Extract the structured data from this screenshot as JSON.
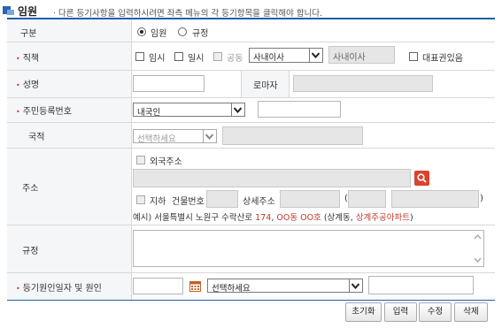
{
  "header": {
    "title": "임원",
    "description": "다른 등기사항을 입력하시려면 좌측 메뉴의 각 등기항목을 클릭해야 합니다."
  },
  "rows": {
    "gubun": {
      "label": "구분",
      "options": [
        "임원",
        "규정"
      ],
      "selected": "임원"
    },
    "position": {
      "label": "직책",
      "checkboxes": [
        "임시",
        "일시",
        "공동"
      ],
      "select_value": "사내이사",
      "readonly_value": "사내이사",
      "rep_checkbox": "대표권있음"
    },
    "name": {
      "label": "성명",
      "name_value": "",
      "roman_label": "로마자",
      "roman_value": ""
    },
    "rrn": {
      "label": "주민등록번호",
      "select_value": "내국인",
      "value": ""
    },
    "nationality": {
      "label": "국적",
      "select_placeholder": "선택하세요",
      "value": ""
    },
    "address": {
      "label": "주소",
      "foreign_checkbox": "외국주소",
      "basement_checkbox": "지하",
      "building_no_label": "건물번호",
      "detail_label": "상세주소",
      "paren_open": "(",
      "paren_close": ")",
      "example_prefix": "예시) 서울특별시 노원구 수락산로",
      "example_num": "174",
      "example_sep": ",",
      "example_dong": "OO동 OO호",
      "example_paren": "(상계동,",
      "example_apt": "상계주공아파트",
      "example_close": ")"
    },
    "rule": {
      "label": "규정",
      "value": ""
    },
    "reg_date": {
      "label": "등기원인일자 및 원인",
      "date_value": "",
      "select_placeholder": "선택하세요",
      "value": ""
    }
  },
  "buttons": {
    "reset": "초기화",
    "input": "입력",
    "modify": "수정",
    "delete": "삭제"
  },
  "colors": {
    "accent": "#1f5fa8",
    "required": "#d33333",
    "example_highlight": "#c0392b",
    "search_button": "#d9432f",
    "calendar_icon": "#c0612b"
  }
}
